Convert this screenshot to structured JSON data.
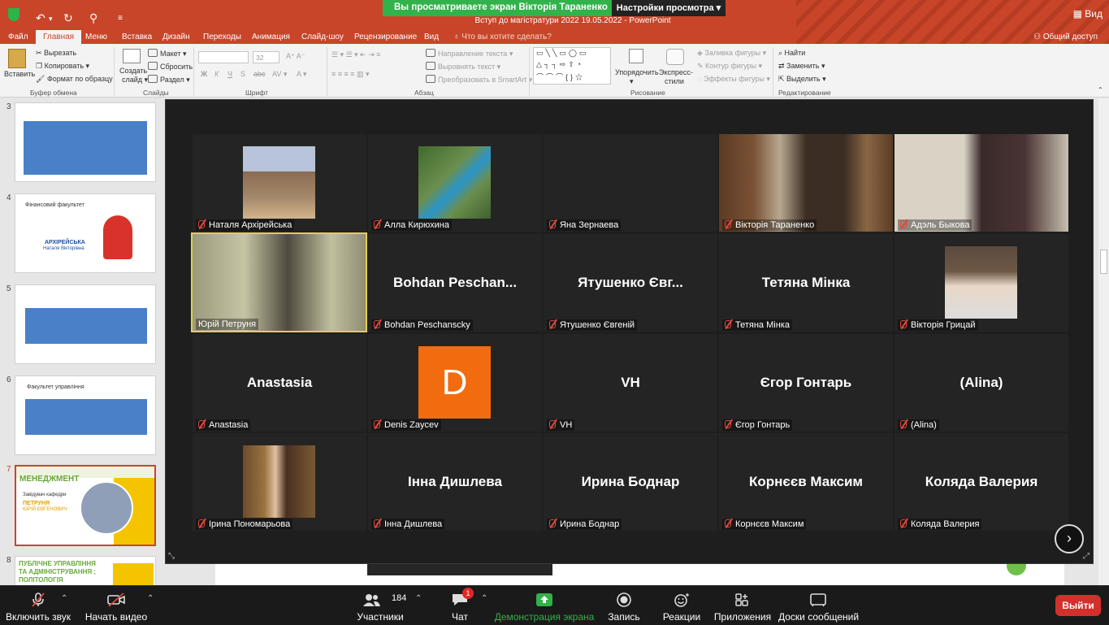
{
  "app": {
    "title": "Вступ до магістратури 2022 19.05.2022 - PowerPoint"
  },
  "share_banner": {
    "text": "Вы просматриваете экран Вікторія Тараненко",
    "view_options": "Настройки просмотра"
  },
  "window": {
    "view_label": "Вид"
  },
  "ppt": {
    "menu": [
      "Файл",
      "Главная",
      "Меню",
      "Вставка",
      "Дизайн",
      "Переходы",
      "Анимация",
      "Слайд-шоу",
      "Рецензирование",
      "Вид"
    ],
    "tell_me": "Что вы хотите сделать?",
    "share": "Общий доступ",
    "clipboard": {
      "paste": "Вставить",
      "cut": "Вырезать",
      "copy": "Копировать",
      "format": "Формат по образцу",
      "group": "Буфер обмена"
    },
    "slides": {
      "create": "Создать",
      "create2": "слайд",
      "layout": "Макет",
      "reset": "Сбросить",
      "section": "Раздел",
      "group": "Слайды"
    },
    "font": {
      "size": "32",
      "group": "Шрифт"
    },
    "paragraph": {
      "direction": "Направление текста",
      "align": "Выровнять текст",
      "smartart": "Преобразовать в SmartArt",
      "group": "Абзац"
    },
    "drawing": {
      "arrange": "Упорядочить",
      "styles": "Экспресс-",
      "styles2": "стили",
      "fill": "Заливка фигуры",
      "outline": "Контур фигуры",
      "effects": "Эффекты фигуры",
      "group": "Рисование"
    },
    "editing": {
      "find": "Найти",
      "replace": "Заменить",
      "select": "Выделить",
      "group": "Редактирование"
    },
    "thumbs": [
      {
        "num": "3"
      },
      {
        "num": "4",
        "title": "Фінансовий факультет",
        "name": "АРХІРЕЙСЬКА",
        "name2": "Наталя Вікторівна"
      },
      {
        "num": "5"
      },
      {
        "num": "6",
        "title": "Факультет управління"
      },
      {
        "num": "7",
        "title": "МЕНЕДЖМЕНТ",
        "sub": "Завідувач кафедри",
        "name": "ПЕТРУНЯ",
        "name2": "ЮРІЙ ЄВГЕНОВИЧ"
      },
      {
        "num": "8",
        "title": "ПУБЛІЧНЕ УПРАВЛІННЯ",
        "title2": "ТА АДМІНІСТРУВАННЯ ;",
        "title3": "ПОЛІТОЛОГІЯ"
      }
    ]
  },
  "gallery": {
    "tiles": [
      {
        "label": "Наталя Архірейська",
        "kind": "photo"
      },
      {
        "label": "Алла Кирюхина",
        "kind": "photo"
      },
      {
        "label": "Яна Зернаева",
        "kind": "empty"
      },
      {
        "label": "Вікторія Тараненко",
        "kind": "video"
      },
      {
        "label": "Адэль Быкова",
        "kind": "video"
      },
      {
        "label": "Юрій Петруня",
        "kind": "video",
        "speaking": true
      },
      {
        "label": "Bohdan Peschanscky",
        "display": "Bohdan  Peschan...",
        "kind": "name"
      },
      {
        "label": "Ятушенко Євгеній",
        "display": "Ятушенко Євг...",
        "kind": "name"
      },
      {
        "label": "Тетяна Мінка",
        "display": "Тетяна Мінка",
        "kind": "name"
      },
      {
        "label": "Вікторія Грицай",
        "kind": "photo"
      },
      {
        "label": "Anastasia",
        "display": "Anastasia",
        "kind": "name"
      },
      {
        "label": "Denis Zaycev",
        "kind": "avatar",
        "avatar": "D"
      },
      {
        "label": "VH",
        "display": "VH",
        "kind": "name"
      },
      {
        "label": "Єгор Гонтарь",
        "display": "Єгор Гонтарь",
        "kind": "name"
      },
      {
        "label": "(Alina)",
        "display": "(Alina)",
        "kind": "name"
      },
      {
        "label": "Ірина Пономарьова",
        "kind": "photo"
      },
      {
        "label": "Інна Дишлева",
        "display": "Інна Дишлева",
        "kind": "name"
      },
      {
        "label": "Ирина Боднар",
        "display": "Ирина Боднар",
        "kind": "name"
      },
      {
        "label": "Корнєєв Максим",
        "display": "Корнєєв Максим",
        "kind": "name"
      },
      {
        "label": "Коляда Валерия",
        "display": "Коляда Валерия",
        "kind": "name"
      }
    ]
  },
  "toolbar": {
    "audio": "Включить звук",
    "video": "Начать видео",
    "participants_count": "184",
    "participants": "Участники",
    "chat": "Чат",
    "chat_badge": "1",
    "share": "Демонстрация экрана",
    "record": "Запись",
    "reactions": "Реакции",
    "apps": "Приложения",
    "whiteboard": "Доски сообщений",
    "leave": "Выйти"
  },
  "colors": {
    "accent": "#c8452a",
    "share_green": "#31b24a",
    "leave_red": "#d3302b",
    "speaker": "#e3d04e"
  }
}
